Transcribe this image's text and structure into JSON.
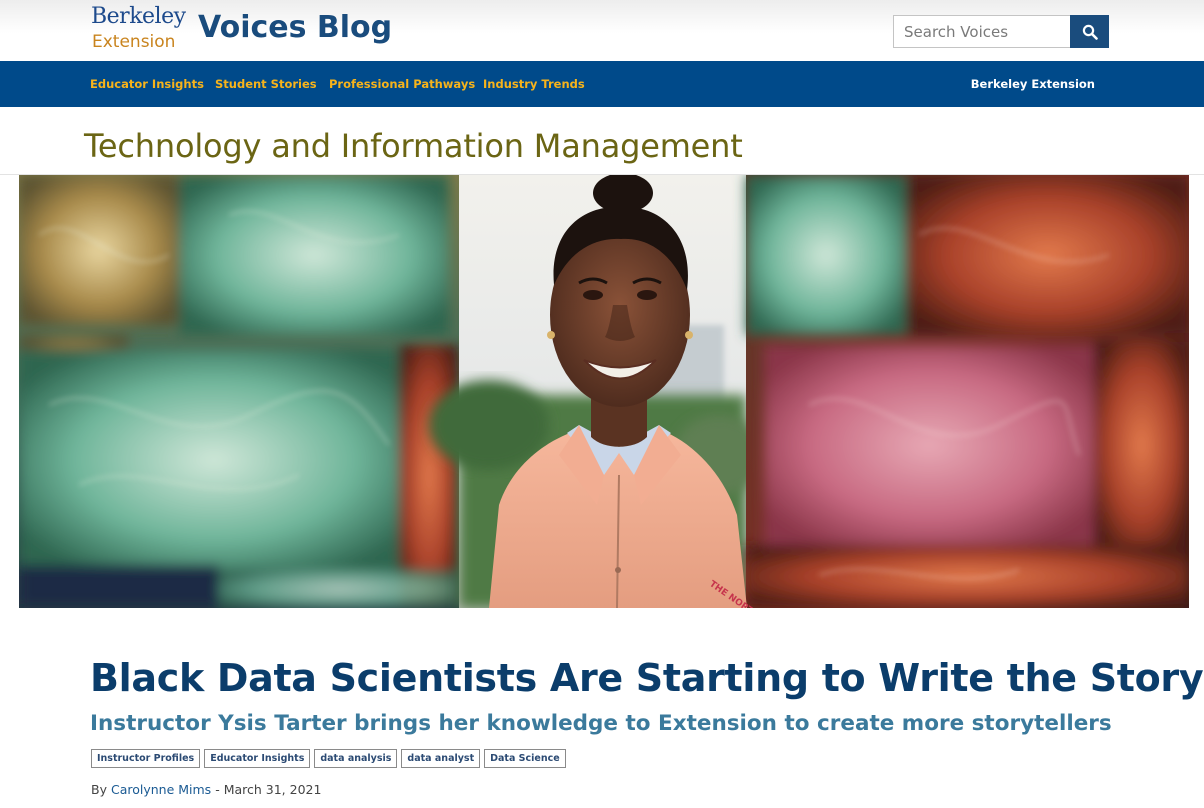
{
  "header": {
    "logo_line1": "Berkeley",
    "logo_line2": "Extension",
    "site_title": "Voices Blog",
    "search_placeholder": "Search Voices",
    "search_icon": "search-icon"
  },
  "nav": {
    "items": [
      {
        "label": "Educator Insights"
      },
      {
        "label": "Student Stories"
      },
      {
        "label": "Professional Pathways"
      },
      {
        "label": "Industry Trends"
      }
    ],
    "right_link": "Berkeley Extension"
  },
  "category": "Technology and Information Management",
  "article": {
    "title": "Black Data Scientists Are Starting to Write the Story",
    "subtitle": "Instructor Ysis Tarter brings her knowledge to Extension to create more storytellers",
    "tags": [
      "Instructor Profiles",
      "Educator Insights",
      "data analysis",
      "data analyst",
      "Data Science"
    ],
    "byline_prefix": "By",
    "author": "Carolynne Mims",
    "date_separator": "-",
    "date": "March 31, 2021"
  },
  "colors": {
    "nav_bg": "#004a8a",
    "nav_link": "#f6b31b",
    "title": "#0b3d6b",
    "subtitle": "#3b7a9c",
    "category": "#6b6514",
    "search_button": "#1a4c7d"
  }
}
